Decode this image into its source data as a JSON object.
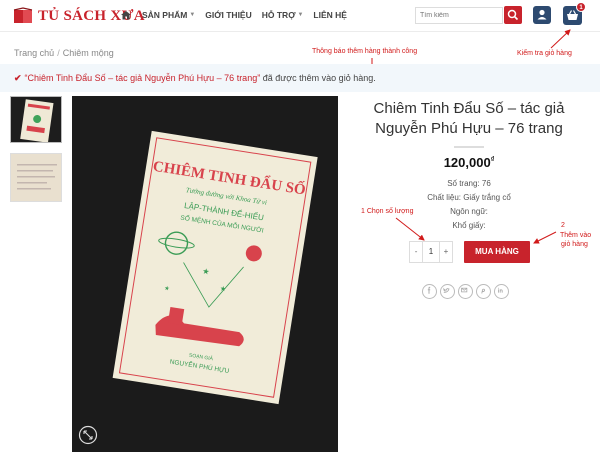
{
  "logo": {
    "text": "TỦ SÁCH XƯA"
  },
  "nav": {
    "items": [
      {
        "label": "SẢN PHẨM",
        "has_caret": true
      },
      {
        "label": "GIỚI THIỆU",
        "has_caret": false
      },
      {
        "label": "HỖ TRỢ",
        "has_caret": true
      },
      {
        "label": "LIÊN HỆ",
        "has_caret": false
      }
    ]
  },
  "search": {
    "placeholder": "Tìm kiếm"
  },
  "cart": {
    "count": "1"
  },
  "breadcrumb": {
    "items": [
      "Trang chủ",
      "Chiêm mộng"
    ]
  },
  "notice": {
    "product": "“Chiêm Tinh Đẩu Số – tác giả Nguyễn Phú Hựu – 76 trang”",
    "message": "đã được thêm vào giỏ hàng."
  },
  "annotations": {
    "success": "Thông báo thêm hàng thành công",
    "check_cart": "Kiểm tra giỏ hàng",
    "step1": "1  Chọn số lượng",
    "step2_num": "2",
    "step2_line1": "Thêm vào",
    "step2_line2": "giỏ hàng"
  },
  "product": {
    "title": "Chiêm Tinh Đẩu Số – tác giả Nguyễn Phú Hựu – 76 trang",
    "price": "120,000",
    "currency": "₫",
    "attributes": [
      "Số trang: 76",
      "Chất liệu: Giấy trắng cổ",
      "Ngôn ngữ:",
      "Khổ giấy:"
    ],
    "quantity": "1",
    "qty_minus": "-",
    "qty_plus": "+",
    "buy_label": "MUA HÀNG"
  },
  "cover": {
    "title": "CHIÊM TINH ĐẨU SỐ",
    "subtitle": "Tướng đường với Khoa Tử vi",
    "line1": "LẬP-THÀNH ĐỂ-HIỂU",
    "line2": "SỐ MỆNH CỦA MỖI NGƯỜI",
    "author_label": "SOẠN GIẢ",
    "author": "NGUYỄN PHÚ HỰU"
  },
  "share_icons": [
    "facebook-icon",
    "twitter-icon",
    "email-icon",
    "pinterest-icon",
    "linkedin-icon"
  ],
  "colors": {
    "accent": "#c8232c",
    "nav_dark": "#2d4a70",
    "annotation": "#d11a1a"
  }
}
